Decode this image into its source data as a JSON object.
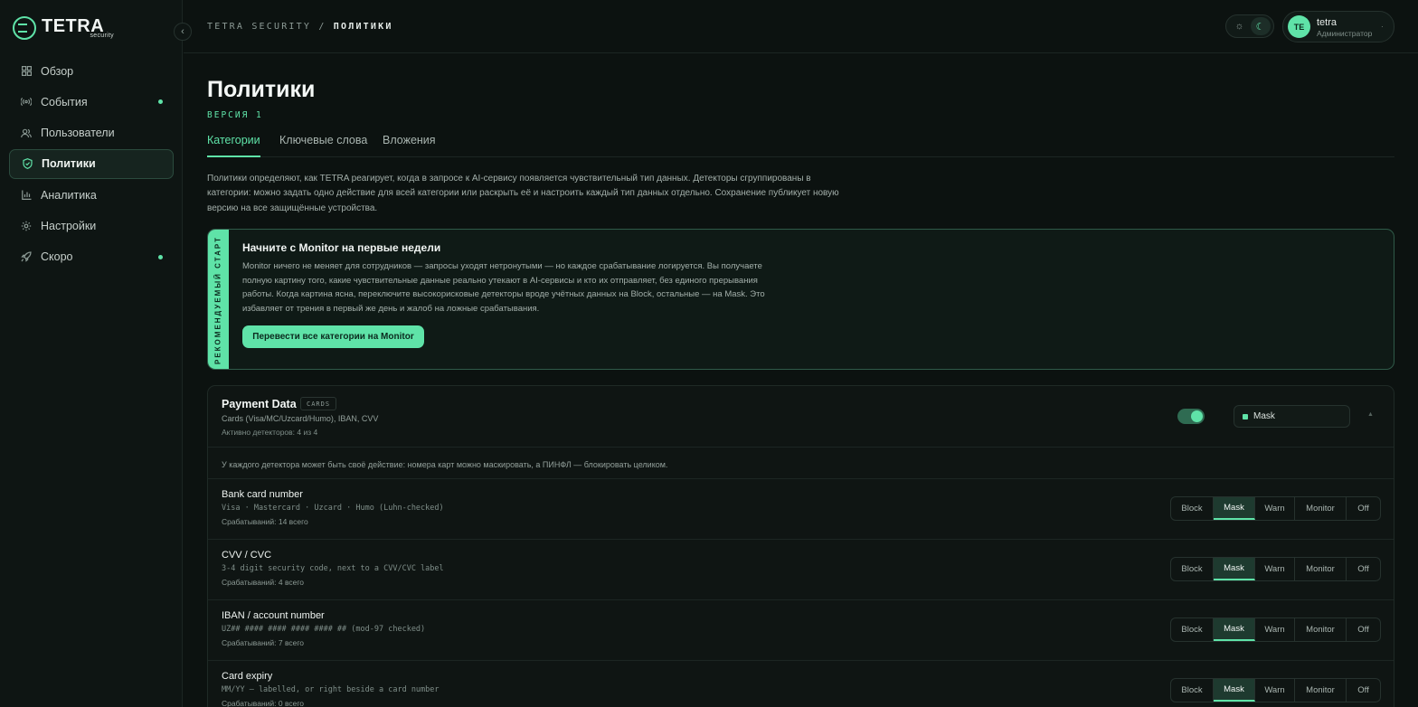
{
  "brand": {
    "name": "TETRA",
    "sub": "security"
  },
  "sidebar": {
    "items": [
      {
        "label": "Обзор",
        "icon": "grid-icon",
        "dot": false,
        "active": false
      },
      {
        "label": "События",
        "icon": "broadcast-icon",
        "dot": true,
        "active": false
      },
      {
        "label": "Пользователи",
        "icon": "users-icon",
        "dot": false,
        "active": false
      },
      {
        "label": "Политики",
        "icon": "shield-icon",
        "dot": false,
        "active": true
      },
      {
        "label": "Аналитика",
        "icon": "bar-chart-icon",
        "dot": false,
        "active": false
      },
      {
        "label": "Настройки",
        "icon": "gear-icon",
        "dot": false,
        "active": false
      },
      {
        "label": "Скоро",
        "icon": "rocket-icon",
        "dot": true,
        "active": false
      }
    ]
  },
  "topbar": {
    "breadcrumb": {
      "root": "TETRA SECURITY",
      "sep": "/",
      "current": "ПОЛИТИКИ"
    },
    "user": {
      "initials": "TE",
      "name": "tetra",
      "role": "Администратор"
    }
  },
  "page": {
    "title": "Политики",
    "version": "ВЕРСИЯ 1",
    "tabs": [
      "Категории",
      "Ключевые слова",
      "Вложения"
    ],
    "intro": "Политики определяют, как TETRA реагирует, когда в запросе к AI-сервису появляется чувствительный тип данных. Детекторы сгруппированы в категории: можно задать одно действие для всей категории или раскрыть её и настроить каждый тип данных отдельно. Сохранение публикует новую версию на все защищённые устройства."
  },
  "recommend": {
    "band": "РЕКОМЕНДУЕМЫЙ СТАРТ",
    "title": "Начните с Monitor на первые недели",
    "body": "Monitor ничего не меняет для сотрудников — запросы уходят нетронутыми — но каждое срабатывание логируется. Вы получаете полную картину того, какие чувствительные данные реально утекают в AI-сервисы и кто их отправляет, без единого прерывания работы. Когда картина ясна, переключите высокорисковые детекторы вроде учётных данных на Block, остальные — на Mask. Это избавляет от трения в первый же день и жалоб на ложные срабатывания.",
    "button": "Перевести все категории на Monitor"
  },
  "category": {
    "title": "Payment Data",
    "badge": "CARDS",
    "subtitle": "Cards (Visa/MC/Uzcard/Humo), IBAN, CVV",
    "active": "Активно детекторов: 4 из 4",
    "enabled": true,
    "action": "Mask",
    "hint": "У каждого детектора может быть своё действие: номера карт можно маскировать, а ПИНФЛ — блокировать целиком.",
    "actions": [
      "Block",
      "Mask",
      "Warn",
      "Monitor",
      "Off"
    ],
    "detectors": [
      {
        "name": "Bank card number",
        "desc": "Visa · Mastercard · Uzcard · Humo (Luhn-checked)",
        "count": "Срабатываний: 14 всего",
        "action": "Mask"
      },
      {
        "name": "CVV / CVC",
        "desc": "3-4 digit security code, next to a CVV/CVC label",
        "count": "Срабатываний: 4 всего",
        "action": "Mask"
      },
      {
        "name": "IBAN / account number",
        "desc": "UZ## #### #### #### #### ## (mod-97 checked)",
        "count": "Срабатываний: 7 всего",
        "action": "Mask"
      },
      {
        "name": "Card expiry",
        "desc": "MM/YY — labelled, or right beside a card number",
        "count": "Срабатываний: 0 всего",
        "action": "Mask"
      }
    ]
  },
  "colors": {
    "accent": "#5fe3a8",
    "background": "#0c1210"
  }
}
